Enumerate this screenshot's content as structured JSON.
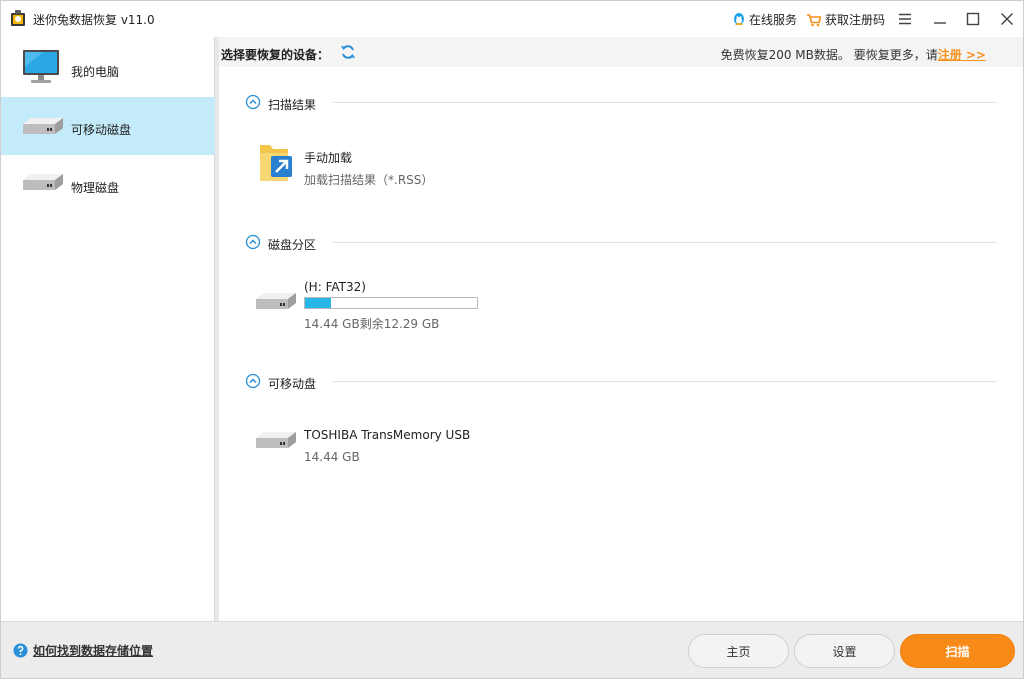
{
  "app": {
    "title": "迷你兔数据恢复 v11.0",
    "online_service": "在线服务",
    "get_code": "获取注册码"
  },
  "sidebar": {
    "items": [
      {
        "label": "我的电脑",
        "active": false
      },
      {
        "label": "可移动磁盘",
        "active": true
      },
      {
        "label": "物理磁盘",
        "active": false
      }
    ]
  },
  "toolbar": {
    "device_label": "选择要恢复的设备：",
    "quota_text": "免费恢复200 MB数据。 要恢复更多，请",
    "register": "注册 >>"
  },
  "sections": {
    "scan_results": {
      "title": "扫描结果",
      "item_name": "手动加载",
      "item_sub": "加载扫描结果（*.RSS）"
    },
    "partitions": {
      "title": "磁盘分区",
      "item_name": "(H: FAT32)",
      "usage_fraction": 0.149,
      "item_sub": "14.44 GB剩余12.29 GB"
    },
    "removable": {
      "title": "可移动盘",
      "item_name": "TOSHIBA TransMemory USB",
      "item_sub": "14.44 GB"
    }
  },
  "footer": {
    "help": "如何找到数据存储位置",
    "home": "主页",
    "settings": "设置",
    "scan": "扫描"
  },
  "colors": {
    "accent": "#f88a18",
    "progress": "#28b6e8",
    "active_bg": "#c3ebfa",
    "link": "#f7921e"
  }
}
